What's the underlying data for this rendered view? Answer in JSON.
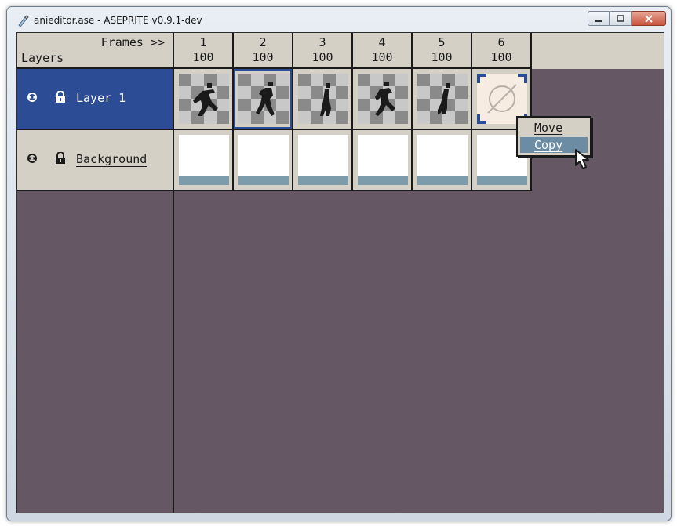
{
  "window": {
    "title": "anieditor.ase - ASEPRITE v0.9.1-dev",
    "buttons": [
      "minimize",
      "maximize",
      "close"
    ]
  },
  "timeline": {
    "corner": {
      "frames_label": "Frames >>",
      "layers_label": "Layers"
    },
    "frames": [
      {
        "number": "1",
        "duration": "100"
      },
      {
        "number": "2",
        "duration": "100"
      },
      {
        "number": "3",
        "duration": "100"
      },
      {
        "number": "4",
        "duration": "100"
      },
      {
        "number": "5",
        "duration": "100"
      },
      {
        "number": "6",
        "duration": "100"
      }
    ],
    "layers": [
      {
        "name": "Layer 1",
        "selected": true
      },
      {
        "name": "Background",
        "selected": false
      }
    ],
    "selected_frame": "2"
  },
  "context_menu": {
    "items": [
      "Move",
      "Copy"
    ],
    "highlighted": "Copy"
  },
  "colors": {
    "selected": "#2c4d96",
    "panel": "#d4d0c6",
    "editor_bg": "#655763",
    "menu_highlight": "#6c8ca4"
  }
}
